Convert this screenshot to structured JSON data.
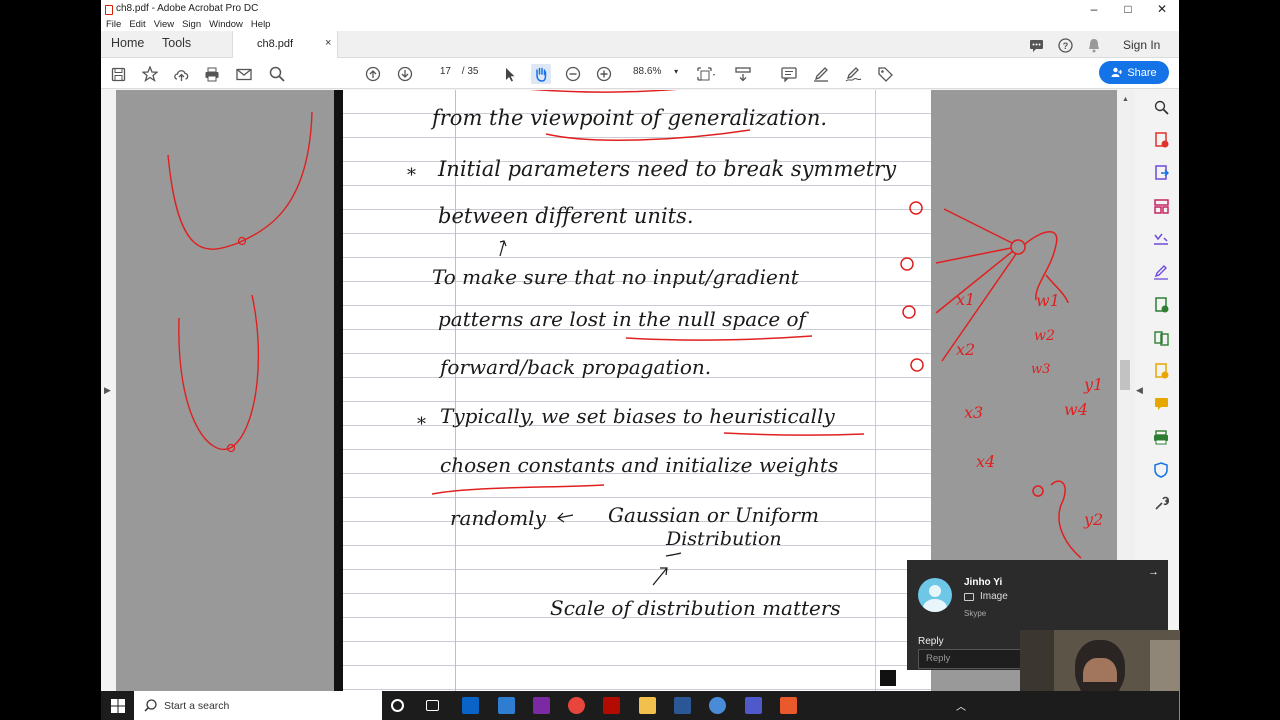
{
  "window": {
    "title": "ch8.pdf - Adobe Acrobat Pro DC",
    "min": "–",
    "max": "□",
    "close": "✕"
  },
  "menu": [
    "File",
    "Edit",
    "View",
    "Sign",
    "Window",
    "Help"
  ],
  "tabs": {
    "home": "Home",
    "tools": "Tools",
    "doc": "ch8.pdf",
    "close": "×"
  },
  "header": {
    "signin": "Sign In"
  },
  "toolbar": {
    "page_current": "17",
    "page_total": "/ 35",
    "zoom": "88.6%",
    "share": "Share"
  },
  "notes": {
    "lines": [
      "from the viewpoint of generalization.",
      "Initial parameters need to break symmetry",
      "between different units.",
      "To make sure that no input/gradient",
      "patterns are lost in the null space of",
      "forward/back propagation.",
      "Typically, we set biases to heuristically",
      "chosen constants and initialize weights",
      "randomly",
      "Gaussian or Uniform",
      "Distribution",
      "Scale of distribution matters"
    ],
    "bullets": [
      "*",
      "*"
    ],
    "diagram": {
      "inputs": [
        "x1",
        "x2",
        "x3",
        "x4"
      ],
      "weights": [
        "w1",
        "w2",
        "w3",
        "w4"
      ],
      "outputs": [
        "y1",
        "y2"
      ]
    }
  },
  "notification": {
    "name": "Jinho Yi",
    "message": "Image",
    "source": "Skype",
    "reply_label": "Reply",
    "reply_placeholder": "Reply",
    "arrow": "→"
  },
  "taskbar": {
    "search": "Start a search"
  },
  "colors": {
    "accent": "#1473e6",
    "ink": "#1a1a1a",
    "red_pen": "#e02020",
    "pdf_red": "#d81e05"
  }
}
